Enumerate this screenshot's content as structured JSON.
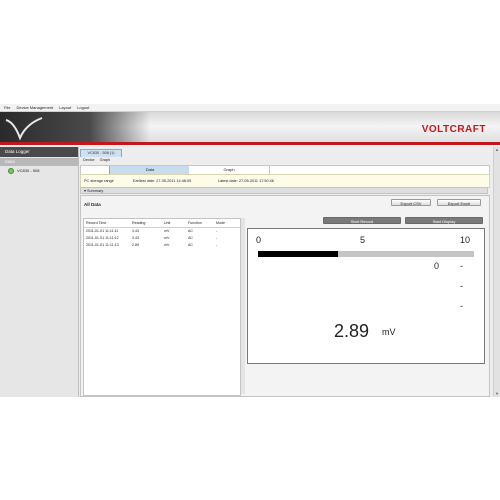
{
  "menu": [
    "File",
    "Device Management",
    "Layout",
    "Logout"
  ],
  "brand": "VOLTCRAFT",
  "sidebar": {
    "header": "Data Logger",
    "section": "DMM",
    "device": "VC830 - 508"
  },
  "device_tab": "VC830 - 508 (1)",
  "sub_tabs": [
    "Device",
    "Graph"
  ],
  "view_tabs": {
    "data": "Data",
    "graph": "Graph"
  },
  "storage": {
    "label": "PC storage range",
    "earliest": "Earliest date: 27-05-2011 14:48:05",
    "latest": "Latest date: 27-05-2011 17:50:46"
  },
  "summary_label": "Summary",
  "all_data": {
    "title": "All Data",
    "export_csv": "Export CSV",
    "export_excel": "Export Excel",
    "start_record": "Start Record",
    "start_display": "Start Display"
  },
  "table": {
    "columns": [
      "Record Time",
      "Reading",
      "Unit",
      "Function",
      "Mode"
    ],
    "rows": [
      [
        "2011-01-01 11:11:11",
        "3.43",
        "mV",
        "AC",
        "-"
      ],
      [
        "2011-01-01 11:11:12",
        "3.43",
        "mV",
        "AC",
        "-"
      ],
      [
        "2011-01-01 11:11:13",
        "2.89",
        "mV",
        "AC",
        "-"
      ]
    ]
  },
  "display": {
    "scale": [
      "0",
      "5",
      "10"
    ],
    "scale_max": 10,
    "bar_fraction": 0.37,
    "readings": [
      "0",
      "-",
      "-",
      "-"
    ],
    "value": "2.89",
    "unit": "mV"
  }
}
